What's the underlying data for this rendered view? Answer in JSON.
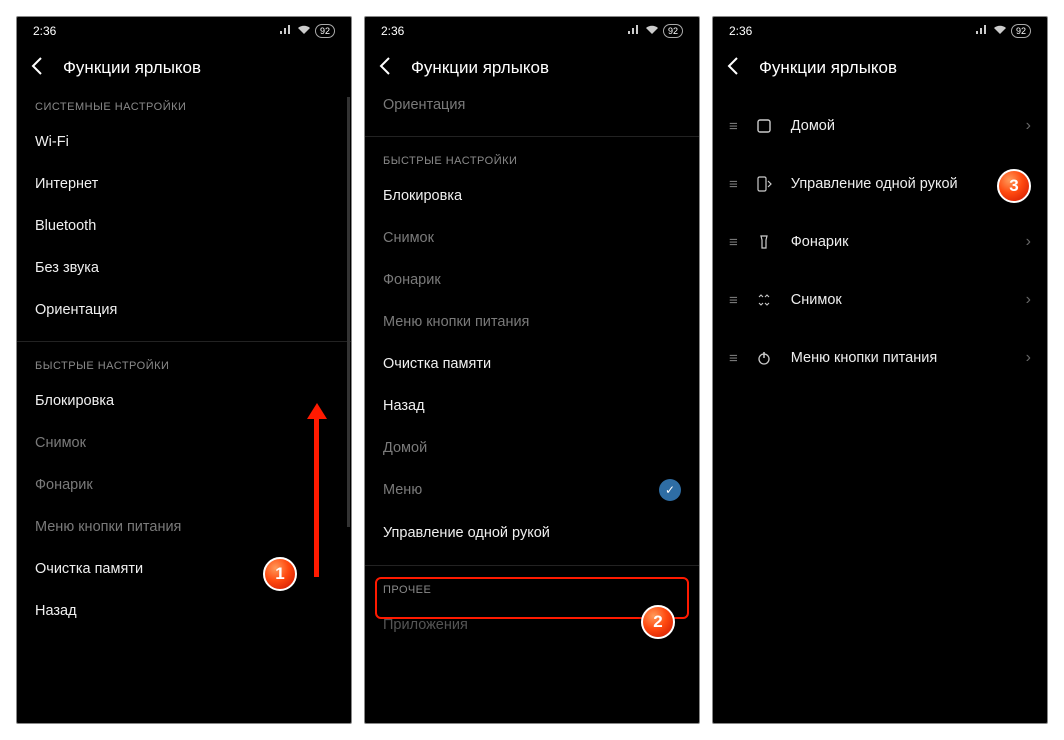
{
  "status": {
    "time": "2:36",
    "battery": "92"
  },
  "header": {
    "title": "Функции ярлыков"
  },
  "screen1": {
    "section1": "СИСТЕМНЫЕ НАСТРОЙКИ",
    "wifi": "Wi-Fi",
    "internet": "Интернет",
    "bluetooth": "Bluetooth",
    "mute": "Без звука",
    "orientation": "Ориентация",
    "section2": "БЫСТРЫЕ НАСТРОЙКИ",
    "lock": "Блокировка",
    "shot": "Снимок",
    "flash": "Фонарик",
    "powermenu": "Меню кнопки питания",
    "ramclean": "Очистка памяти",
    "back": "Назад"
  },
  "screen2": {
    "orientation_cut": "Ориентация",
    "section2": "БЫСТРЫЕ НАСТРОЙКИ",
    "lock": "Блокировка",
    "shot": "Снимок",
    "flash": "Фонарик",
    "powermenu": "Меню кнопки питания",
    "ramclean": "Очистка памяти",
    "back": "Назад",
    "home": "Домой",
    "menu": "Меню",
    "onehand": "Управление одной рукой",
    "section3": "ПРОЧЕЕ",
    "apps_cut": "Приложения"
  },
  "screen3": {
    "rows": [
      {
        "icon": "home",
        "label": "Домой"
      },
      {
        "icon": "onehand",
        "label": "Управление одной рукой"
      },
      {
        "icon": "flash",
        "label": "Фонарик"
      },
      {
        "icon": "shot",
        "label": "Снимок"
      },
      {
        "icon": "power",
        "label": "Меню кнопки питания"
      }
    ]
  },
  "steps": {
    "1": "1",
    "2": "2",
    "3": "3"
  }
}
